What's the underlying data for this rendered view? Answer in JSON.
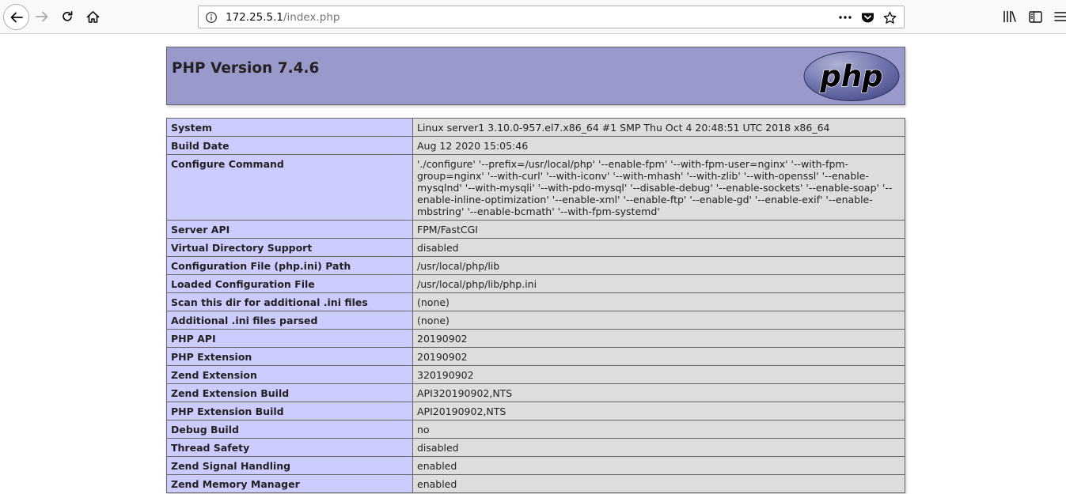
{
  "browser": {
    "url_host": "172.25.5.1",
    "url_path": "/index.php",
    "icons": {
      "back": "arrow-left-icon",
      "forward": "arrow-right-icon",
      "reload": "reload-icon",
      "home": "home-icon",
      "info": "info-icon",
      "page_actions": "ellipsis-icon",
      "pocket": "pocket-icon",
      "bookmark": "star-icon",
      "library": "library-icon",
      "sidebar": "sidebar-icon",
      "menu": "hamburger-menu-icon"
    }
  },
  "page": {
    "title": "PHP Version 7.4.6",
    "logo_text": "php",
    "colors": {
      "header_bg": "#9999cc",
      "key_bg": "#ccccff",
      "value_bg": "#dddddd",
      "border": "#666666"
    },
    "rows": [
      {
        "key": "System",
        "value": "Linux server1 3.10.0-957.el7.x86_64 #1 SMP Thu Oct 4 20:48:51 UTC 2018 x86_64"
      },
      {
        "key": "Build Date",
        "value": "Aug 12 2020 15:05:46"
      },
      {
        "key": "Configure Command",
        "value": "'./configure' '--prefix=/usr/local/php' '--enable-fpm' '--with-fpm-user=nginx' '--with-fpm-group=nginx' '--with-curl' '--with-iconv' '--with-mhash' '--with-zlib' '--with-openssl' '--enable-mysqlnd' '--with-mysqli' '--with-pdo-mysql' '--disable-debug' '--enable-sockets' '--enable-soap' '--enable-inline-optimization' '--enable-xml' '--enable-ftp' '--enable-gd' '--enable-exif' '--enable-mbstring' '--enable-bcmath' '--with-fpm-systemd'"
      },
      {
        "key": "Server API",
        "value": "FPM/FastCGI"
      },
      {
        "key": "Virtual Directory Support",
        "value": "disabled"
      },
      {
        "key": "Configuration File (php.ini) Path",
        "value": "/usr/local/php/lib"
      },
      {
        "key": "Loaded Configuration File",
        "value": "/usr/local/php/lib/php.ini"
      },
      {
        "key": "Scan this dir for additional .ini files",
        "value": "(none)"
      },
      {
        "key": "Additional .ini files parsed",
        "value": "(none)"
      },
      {
        "key": "PHP API",
        "value": "20190902"
      },
      {
        "key": "PHP Extension",
        "value": "20190902"
      },
      {
        "key": "Zend Extension",
        "value": "320190902"
      },
      {
        "key": "Zend Extension Build",
        "value": "API320190902,NTS"
      },
      {
        "key": "PHP Extension Build",
        "value": "API20190902,NTS"
      },
      {
        "key": "Debug Build",
        "value": "no"
      },
      {
        "key": "Thread Safety",
        "value": "disabled"
      },
      {
        "key": "Zend Signal Handling",
        "value": "enabled"
      },
      {
        "key": "Zend Memory Manager",
        "value": "enabled"
      }
    ]
  }
}
